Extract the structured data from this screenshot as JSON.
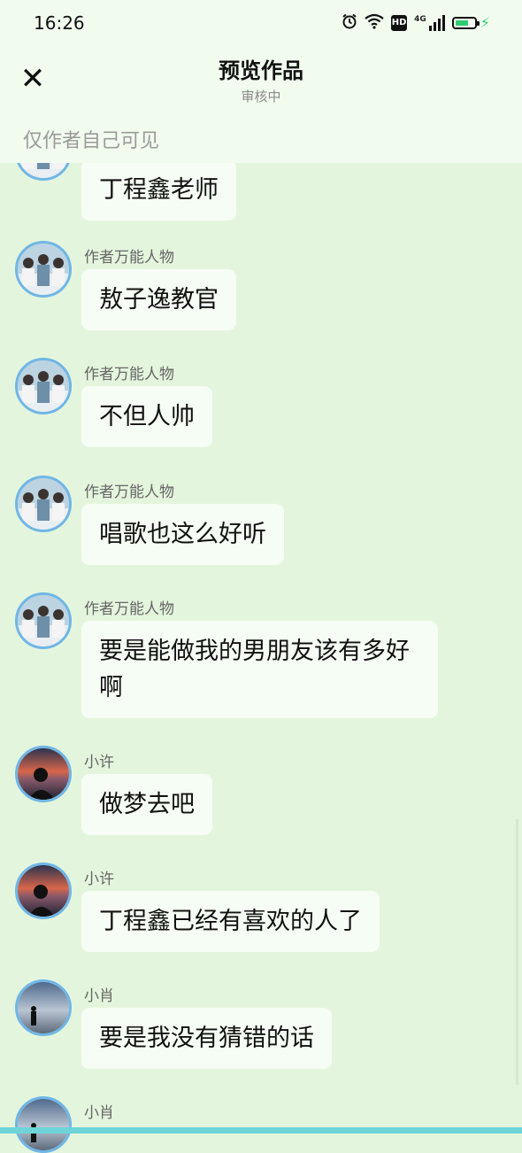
{
  "status_bar": {
    "time": "16:26",
    "hd": "HD",
    "network": "4G"
  },
  "header": {
    "title": "预览作品",
    "subtitle": "审核中",
    "visibility_note": "仅作者自己可见"
  },
  "messages": [
    {
      "sender": "",
      "text": "丁程鑫老师",
      "avatar": "group-photo-avatar"
    },
    {
      "sender": "作者万能人物",
      "text": "敖子逸教官",
      "avatar": "group-photo-avatar"
    },
    {
      "sender": "作者万能人物",
      "text": "不但人帅",
      "avatar": "group-photo-avatar"
    },
    {
      "sender": "作者万能人物",
      "text": "唱歌也这么好听",
      "avatar": "group-photo-avatar"
    },
    {
      "sender": "作者万能人物",
      "text": "要是能做我的男朋友该有多好啊",
      "avatar": "group-photo-avatar"
    },
    {
      "sender": "小许",
      "text": "做梦去吧",
      "avatar": "sunset-person-avatar"
    },
    {
      "sender": "小许",
      "text": "丁程鑫已经有喜欢的人了",
      "avatar": "sunset-person-avatar"
    },
    {
      "sender": "小肖",
      "text": "要是我没有猜错的话",
      "avatar": "lone-figure-avatar"
    },
    {
      "sender": "小肖",
      "text": "",
      "avatar": "lone-figure-avatar"
    }
  ],
  "colors": {
    "background": "#e4f5dd",
    "header": "#f1fcef",
    "bubble": "#f6fdf4",
    "avatar_ring": "#6fb6e6",
    "battery": "#2ecc71"
  }
}
